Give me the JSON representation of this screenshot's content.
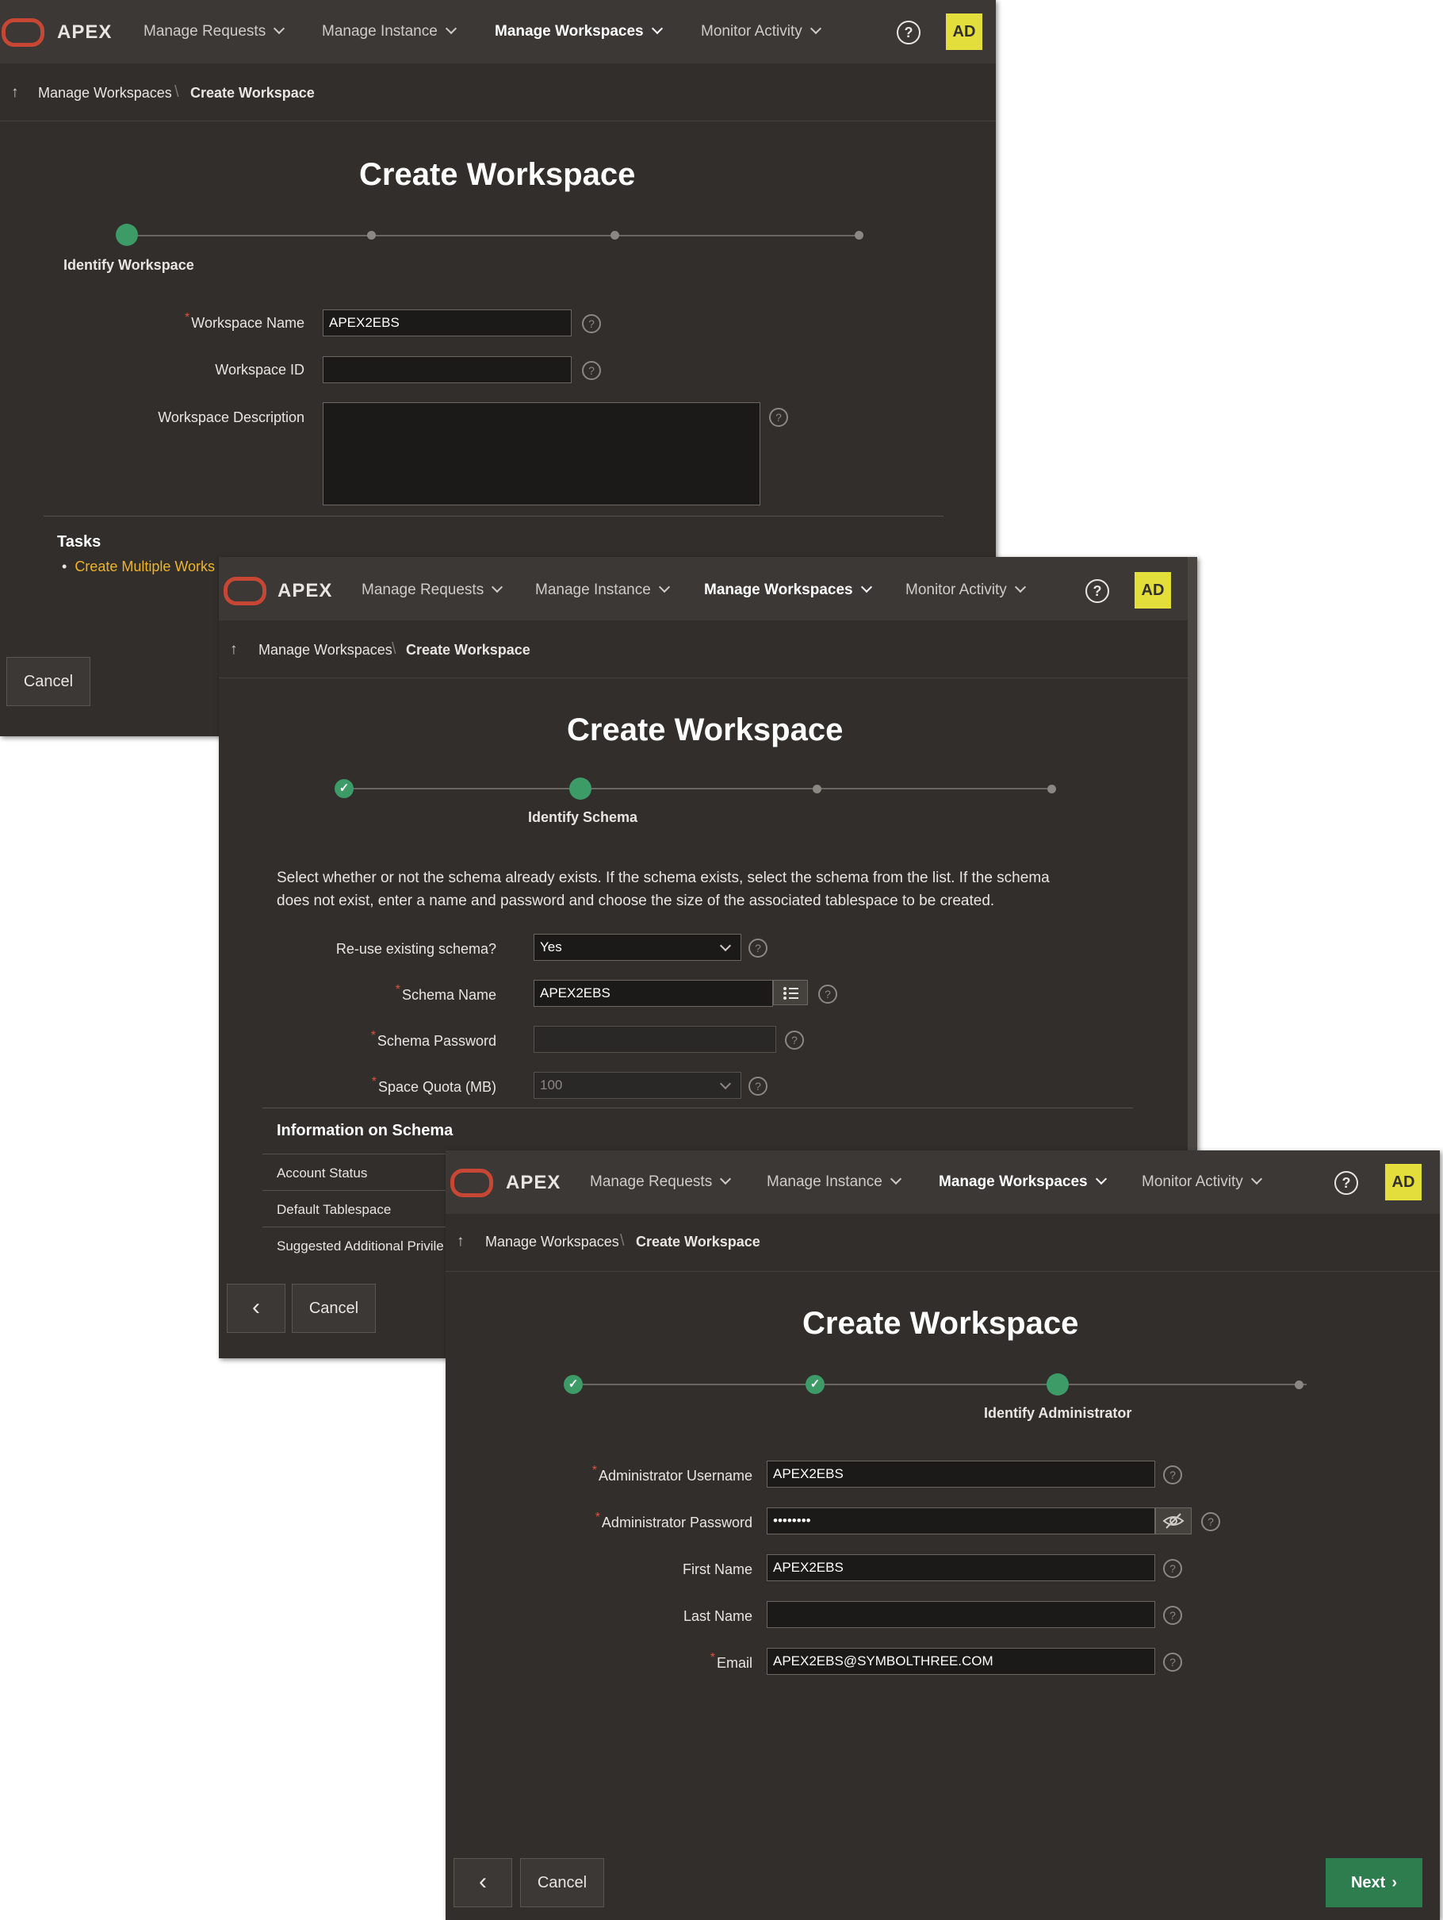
{
  "nav": {
    "brand": "APEX",
    "items": [
      "Manage Requests",
      "Manage Instance",
      "Manage Workspaces",
      "Monitor Activity"
    ],
    "help": "?",
    "avatar": "AD"
  },
  "breadcrumb": {
    "up": "↑",
    "parent": "Manage Workspaces",
    "separator": "\\",
    "current": "Create Workspace"
  },
  "page_title": "Create Workspace",
  "panel1": {
    "step_label": "Identify Workspace",
    "fields": {
      "workspace_name_label": "Workspace Name",
      "workspace_name_value": "APEX2EBS",
      "workspace_id_label": "Workspace ID",
      "workspace_id_value": "",
      "workspace_description_label": "Workspace Description",
      "workspace_description_value": ""
    },
    "tasks_title": "Tasks",
    "task_link": "Create Multiple Works",
    "cancel": "Cancel"
  },
  "panel2": {
    "step_label": "Identify Schema",
    "intro": "Select whether or not the schema already exists. If the schema exists, select the schema from the list. If the schema does not exist, enter a name and password and choose the size of the associated tablespace to be created.",
    "fields": {
      "reuse_label": "Re-use existing schema?",
      "reuse_value": "Yes",
      "schema_name_label": "Schema Name",
      "schema_name_value": "APEX2EBS",
      "schema_password_label": "Schema Password",
      "schema_password_value": "",
      "space_quota_label": "Space Quota (MB)",
      "space_quota_value": "100"
    },
    "info_title": "Information on Schema",
    "info_rows": [
      "Account Status",
      "Default Tablespace",
      "Suggested Additional Privile"
    ],
    "back": "‹",
    "cancel": "Cancel"
  },
  "panel3": {
    "step_label": "Identify Administrator",
    "fields": {
      "admin_username_label": "Administrator Username",
      "admin_username_value": "APEX2EBS",
      "admin_password_label": "Administrator Password",
      "admin_password_value": "••••••••",
      "first_name_label": "First Name",
      "first_name_value": "APEX2EBS",
      "last_name_label": "Last Name",
      "last_name_value": "",
      "email_label": "Email",
      "email_value": "APEX2EBS@SYMBOLTHREE.COM"
    },
    "back": "‹",
    "cancel": "Cancel",
    "next": "Next"
  },
  "colors": {
    "background": "#312e2b",
    "topbar": "#3b3835",
    "accent_green": "#3d9b67",
    "logo_red": "#c74634",
    "avatar_yellow": "#e3de3b",
    "link_gold": "#f0b429"
  },
  "icons": [
    "oracle-logo-icon",
    "chevron-down-icon",
    "help-icon",
    "up-arrow-icon",
    "question-icon",
    "check-icon",
    "list-icon",
    "eye-slash-icon",
    "chevron-left-icon",
    "chevron-right-icon"
  ]
}
